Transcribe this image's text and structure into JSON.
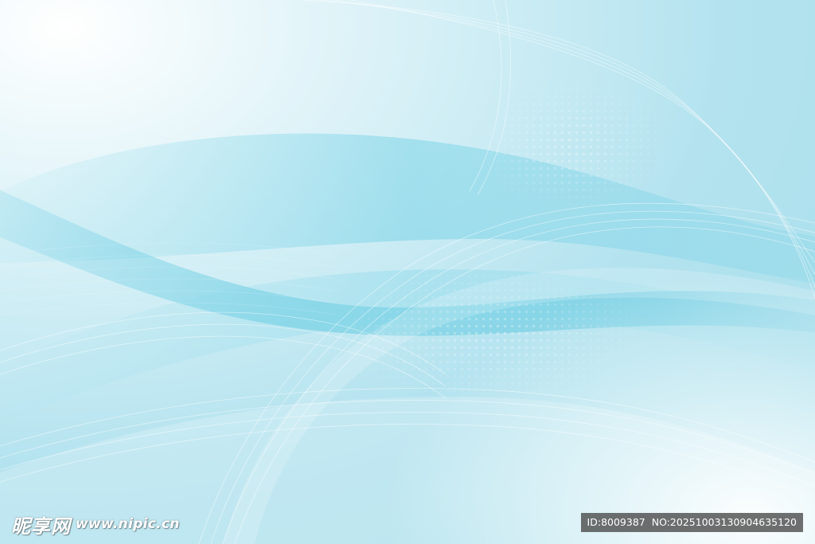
{
  "image": {
    "description_colors": {
      "base": "#bfe6f0",
      "light": "#f4fbfd",
      "accent": "#5cc8e0",
      "deep": "#3bb8d8"
    }
  },
  "watermark": {
    "logo_text": "昵享网",
    "site_url": "www.nipic.cn"
  },
  "id_badge": {
    "id_text": "ID:8009387",
    "no_text": "NO:20251003130904635120"
  }
}
